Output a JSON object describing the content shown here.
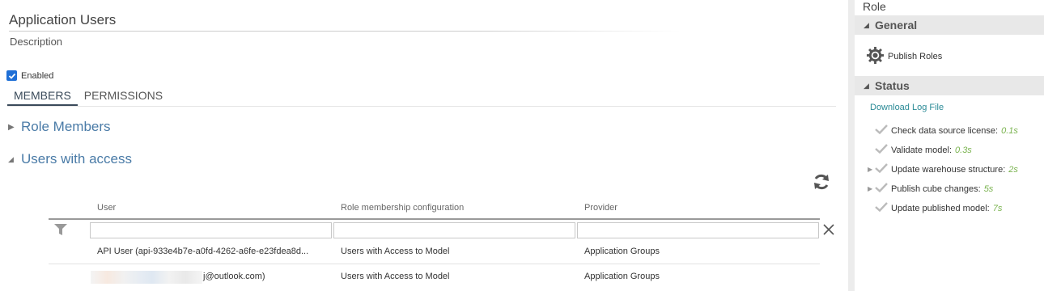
{
  "header": {
    "title": "Application Users",
    "description": "Description",
    "enabled_label": "Enabled"
  },
  "tabs": [
    {
      "label": "MEMBERS",
      "active": true
    },
    {
      "label": "PERMISSIONS",
      "active": false
    }
  ],
  "sections": {
    "role_members": "Role Members",
    "users_with_access": "Users with access"
  },
  "grid": {
    "columns": [
      "User",
      "Role membership configuration",
      "Provider"
    ],
    "rows": [
      {
        "user": "API User (api-933e4b7e-a0fd-4262-a6fe-e23fdea8d...",
        "config": "Users with Access to Model",
        "provider": "Application Groups"
      },
      {
        "user": "j@outlook.com)",
        "config": "Users with Access to Model",
        "provider": "Application Groups"
      }
    ]
  },
  "side": {
    "title": "Role",
    "general_label": "General",
    "publish_label": "Publish Roles",
    "status_label": "Status",
    "download_link": "Download Log File",
    "steps": [
      {
        "label": "Check data source license:",
        "time": "0.1s",
        "expandable": false
      },
      {
        "label": "Validate model:",
        "time": "0.3s",
        "expandable": false
      },
      {
        "label": "Update warehouse structure:",
        "time": "2s",
        "expandable": true
      },
      {
        "label": "Publish cube changes:",
        "time": "5s",
        "expandable": true
      },
      {
        "label": "Update published model:",
        "time": "7s",
        "expandable": false
      }
    ]
  },
  "colors": {
    "accent_link": "#4a7ba7",
    "checkbox": "#1f6fd6",
    "success": "#7ab34f",
    "teal_link": "#2a8a96"
  }
}
